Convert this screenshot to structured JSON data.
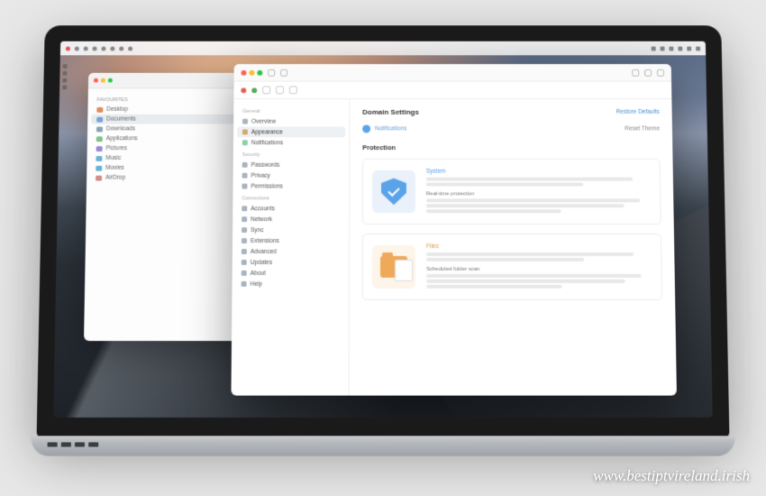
{
  "watermark": "www.bestiptvireland.irish",
  "finder": {
    "heading": "Favourites",
    "items": [
      {
        "label": "Desktop",
        "color": "#e28c5b",
        "active": false
      },
      {
        "label": "Documents",
        "color": "#7aa2d6",
        "active": true
      },
      {
        "label": "Downloads",
        "color": "#8aa3b5",
        "active": false
      },
      {
        "label": "Applications",
        "color": "#7fc28a",
        "active": false
      },
      {
        "label": "Pictures",
        "color": "#9a8ad6",
        "active": false
      },
      {
        "label": "Music",
        "color": "#6ab3d6",
        "active": false
      },
      {
        "label": "Movies",
        "color": "#6ab3d6",
        "active": false
      },
      {
        "label": "AirDrop",
        "color": "#d68a8a",
        "active": false
      }
    ]
  },
  "app": {
    "header": {
      "title": "Domain Settings",
      "action": "Restore Defaults"
    },
    "breadcrumb": {
      "label": "Notifications",
      "right": "Reset Theme"
    },
    "section_title": "Protection",
    "sidebar": {
      "groups": [
        {
          "heading": "General",
          "items": [
            {
              "label": "Overview",
              "color": "#a8b4c0",
              "active": false
            },
            {
              "label": "Appearance",
              "color": "#d6a86a",
              "active": true
            },
            {
              "label": "Notifications",
              "color": "#8ad0a2",
              "active": false
            }
          ]
        },
        {
          "heading": "Security",
          "items": [
            {
              "label": "Passwords",
              "color": "#a8b4c0",
              "active": false
            },
            {
              "label": "Privacy",
              "color": "#a8b4c0",
              "active": false
            },
            {
              "label": "Permissions",
              "color": "#a8b4c0",
              "active": false
            }
          ]
        },
        {
          "heading": "Connections",
          "items": [
            {
              "label": "Accounts",
              "color": "#a8b4c0",
              "active": false
            },
            {
              "label": "Network",
              "color": "#a8b4c0",
              "active": false
            },
            {
              "label": "Sync",
              "color": "#a8b4c0",
              "active": false
            },
            {
              "label": "Extensions",
              "color": "#a8b4c0",
              "active": false
            },
            {
              "label": "Advanced",
              "color": "#a8b4c0",
              "active": false
            },
            {
              "label": "Updates",
              "color": "#a8b4c0",
              "active": false
            },
            {
              "label": "About",
              "color": "#a8b4c0",
              "active": false
            },
            {
              "label": "Help",
              "color": "#a8b4c0",
              "active": false
            }
          ]
        }
      ]
    },
    "cards": [
      {
        "title": "System",
        "subtitle": "Real-time protection",
        "variant": "blue"
      },
      {
        "title": "Files",
        "subtitle": "Scheduled folder scan",
        "variant": "orange"
      }
    ]
  }
}
